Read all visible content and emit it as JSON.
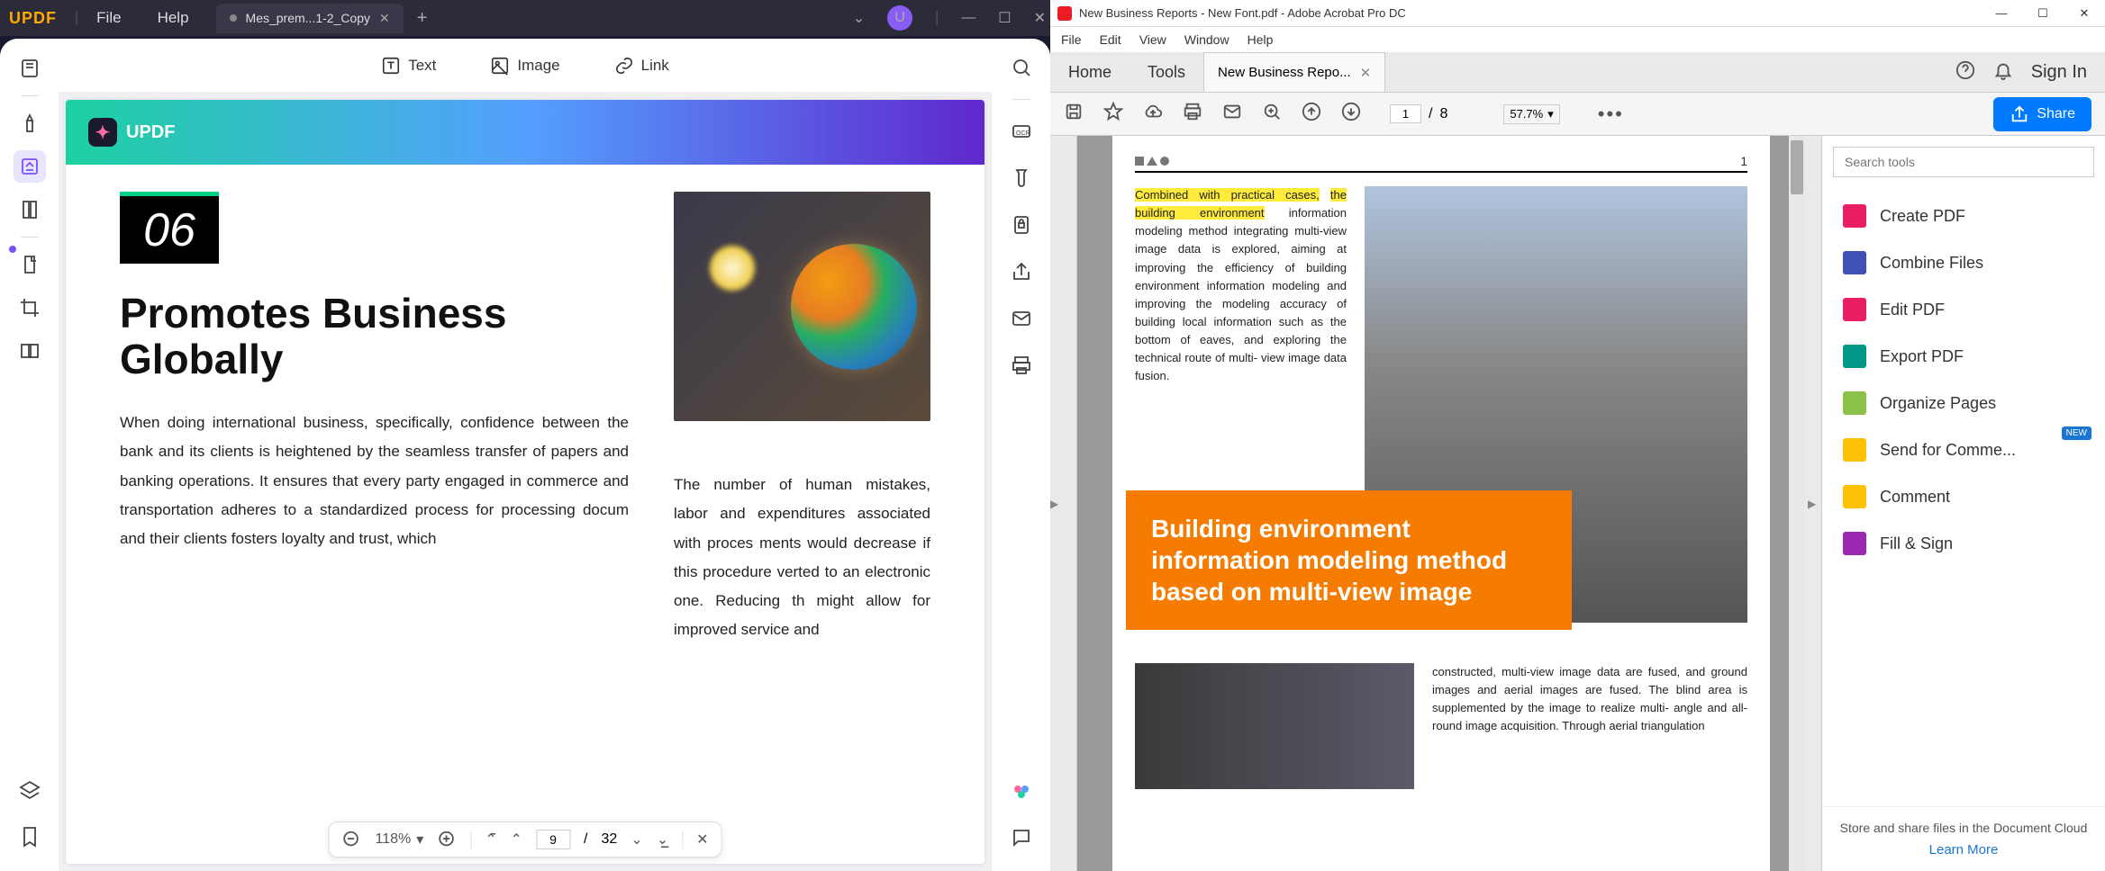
{
  "updf": {
    "logo": "UPDF",
    "menu": {
      "file": "File",
      "help": "Help"
    },
    "tab": {
      "title": "Mes_prem...1-2_Copy"
    },
    "avatar_letter": "U",
    "toolbar": {
      "text": "Text",
      "image": "Image",
      "link": "Link"
    },
    "page_banner_brand": "UPDF",
    "page": {
      "number": "06",
      "heading": "Promotes Business Globally",
      "left_text": "When doing international business, specifically, confidence between the bank and its clients is heightened by the seamless transfer of papers and banking operations. It ensures that every party engaged in commerce and transportation adheres to a standardized process for processing docum                                                                                                          and their clients fosters loyalty and trust, which",
      "right_text": "The number of human mistakes, labor and expenditures associated with proces ments would decrease if this procedure verted to an electronic one. Reducing th might allow for improved service and"
    },
    "bottom_nav": {
      "zoom": "118%",
      "page_current": "9",
      "page_sep": "/",
      "page_total": "32"
    }
  },
  "acrobat": {
    "title": "New Business Reports - New Font.pdf - Adobe Acrobat Pro DC",
    "menu": {
      "file": "File",
      "edit": "Edit",
      "view": "View",
      "window": "Window",
      "help": "Help"
    },
    "tabs": {
      "home": "Home",
      "tools": "Tools",
      "doc": "New Business Repo..."
    },
    "signin": "Sign In",
    "toolbar": {
      "page_current": "1",
      "page_sep": "/",
      "page_total": "8",
      "zoom": "57.7%"
    },
    "share_btn": "Share",
    "page": {
      "page_number": "1",
      "highlight1": "Combined with practical cases,",
      "highlight2": "the building environment",
      "para1_rest": " information modeling method integrating multi-view image data is explored, aiming at improving the efficiency of building environment information modeling and improving the modeling accuracy of building local information such as the bottom of eaves, and exploring the technical route of multi- view image data fusion.",
      "orange_heading": "Building environment information modeling method based on multi-view image",
      "para2": "constructed, multi-view image data are fused, and ground images and aerial images are fused. The blind area is supplemented by the image to realize multi- angle and all-round image acquisition. Through aerial triangulation"
    },
    "rightpanel": {
      "search_placeholder": "Search tools",
      "tools": {
        "create": "Create PDF",
        "combine": "Combine Files",
        "edit": "Edit PDF",
        "export": "Export PDF",
        "organize": "Organize Pages",
        "send": "Send for Comme...",
        "comment": "Comment",
        "fill": "Fill & Sign"
      },
      "new_badge": "NEW",
      "cloud_text": "Store and share files in the Document Cloud",
      "learn_more": "Learn More"
    }
  }
}
